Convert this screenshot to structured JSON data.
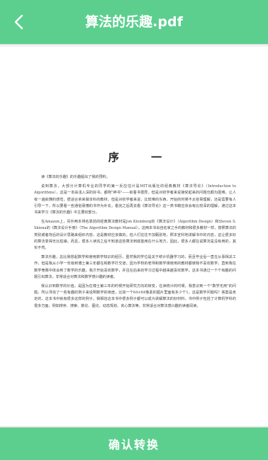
{
  "header": {
    "title": "算法的乐趣.pdf",
    "back_icon": "chevron-left-icon",
    "bg_color": "#5ccf8f"
  },
  "document": {
    "heading": "序 一",
    "paragraphs": [
      "读《算法的乐趣》的乐趣超出了我的预料。",
      "说到算法，大部分计算机专业的同学的第一反应估计是MIT出版社的经典教材《算法导论》（Introduction to Algorithms），这是一本由浅入深的好书，都称\"神书\"——就看书很厚，但是对初学者来说接受起来的问题也颇为困难。让人有一遍就懂的感觉，很适合拿来做本科的教材，但是对初学者来说，比较难的东西，开始的时候不太容易理解，还是需要有人引导一下，所以要看一些通俗易懂的书作为补充，看完之后再去看《算法导论》这一类书籍应该会有比较深的理解，通过这本书来学习《算法的乐趣》中主要的部分。",
      "在Amazon上，另外两本排名靠前的经典算法教材是Jon Kleinberg的《算法设计》（Algorithm Design）和Steven S. Skiena的《算法设计手册》（The Algorithm Design Manual）。这两本书出自名家之手的教材和很多教材一样，按照算法的类别或者背后的设计思路来组织内容，这是教材应该做的。但人们往往不加甄别地，照本宣科地讲解书中的内容，这让很多好的算法变得无比枯燥，而且，很多人读完之后不知道这些算法到底能用在什么地方。因此，很多人都在说算法是没有用的，其实不然。",
      "算法乐趣，总比我想起数学和使用数学知识的经历，虽然我的学位是关于统计机器学习的，而且毕业后一直在从事相关工作，但是我从小学一年级到博士第三年都在和数学打交道。因为学校的老师和数学课使用的教材都使我不喜欢数学，直到我在数学竞赛中体会到了数学的乐趣，我才开始喜欢数学，并且在后来的学习过程中越来越喜欢数学。这本书通过一个个有趣的问题引出算法，非常适合对算法和数学感兴趣的读者。",
      "我认识到数学的价值，是因为在博士第三年的时候开始研究方向的转变，在读统计的时候，我意识到一个\"数学无用\"的问题，所以寻找了一些有趣的例子来说明数学的用途，比如一个64×64像素的图片里面有多少个1，这是数学问题吗？答案是肯定的，这本书中就有很多这样的例子，我相信这本书中很多例子都可以成为讲解算法的好材料，书中例子包括了计算机学科的很多方面，例如排序、搜索、数论、图论、动态规划、贪心算法等，非常适合对算法感兴趣的读者阅读。"
    ]
  },
  "footer": {
    "confirm_label": "确认转换"
  }
}
